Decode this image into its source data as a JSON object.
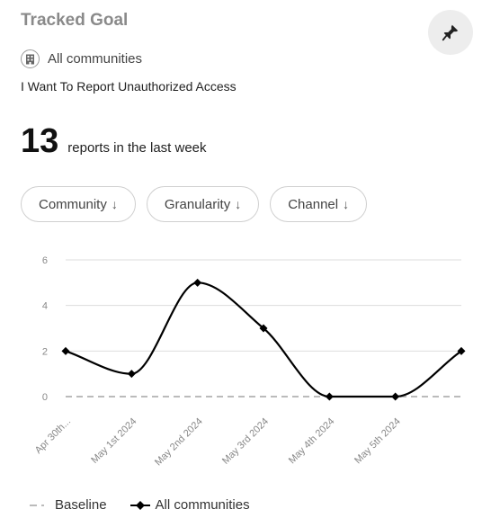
{
  "header": {
    "title": "Tracked Goal",
    "community": "All communities",
    "goal_name": "I Want To Report Unauthorized Access"
  },
  "summary": {
    "count": "13",
    "label": "reports in the last week"
  },
  "filters": [
    {
      "label": "Community",
      "icon": "arrow-down-icon"
    },
    {
      "label": "Granularity",
      "icon": "arrow-down-icon"
    },
    {
      "label": "Channel",
      "icon": "arrow-down-icon"
    }
  ],
  "icons": {
    "pin": "pin-icon",
    "community": "building-icon"
  },
  "colors": {
    "series": "#000000",
    "baseline": "#bbbbbb",
    "grid": "#dddddd",
    "tick_text": "#888888"
  },
  "chart_data": {
    "type": "line",
    "categories": [
      "Apr 30th...",
      "May 1st 2024",
      "May 2nd 2024",
      "May 3rd 2024",
      "May 4th 2024",
      "May 5th 2024",
      ""
    ],
    "yticks": [
      0,
      2,
      4,
      6
    ],
    "ylim": [
      0,
      6
    ],
    "grid": true,
    "legend_position": "bottom-left",
    "series": [
      {
        "name": "All communities",
        "values": [
          2,
          1,
          5,
          3,
          0,
          0,
          2
        ],
        "color": "#000000",
        "marker": "diamond"
      },
      {
        "name": "Baseline",
        "values": [
          0,
          0,
          0,
          0,
          0,
          0,
          0
        ],
        "color": "#bbbbbb",
        "style": "dashed"
      }
    ]
  },
  "legend": {
    "baseline": "Baseline",
    "all_communities": "All communities"
  }
}
